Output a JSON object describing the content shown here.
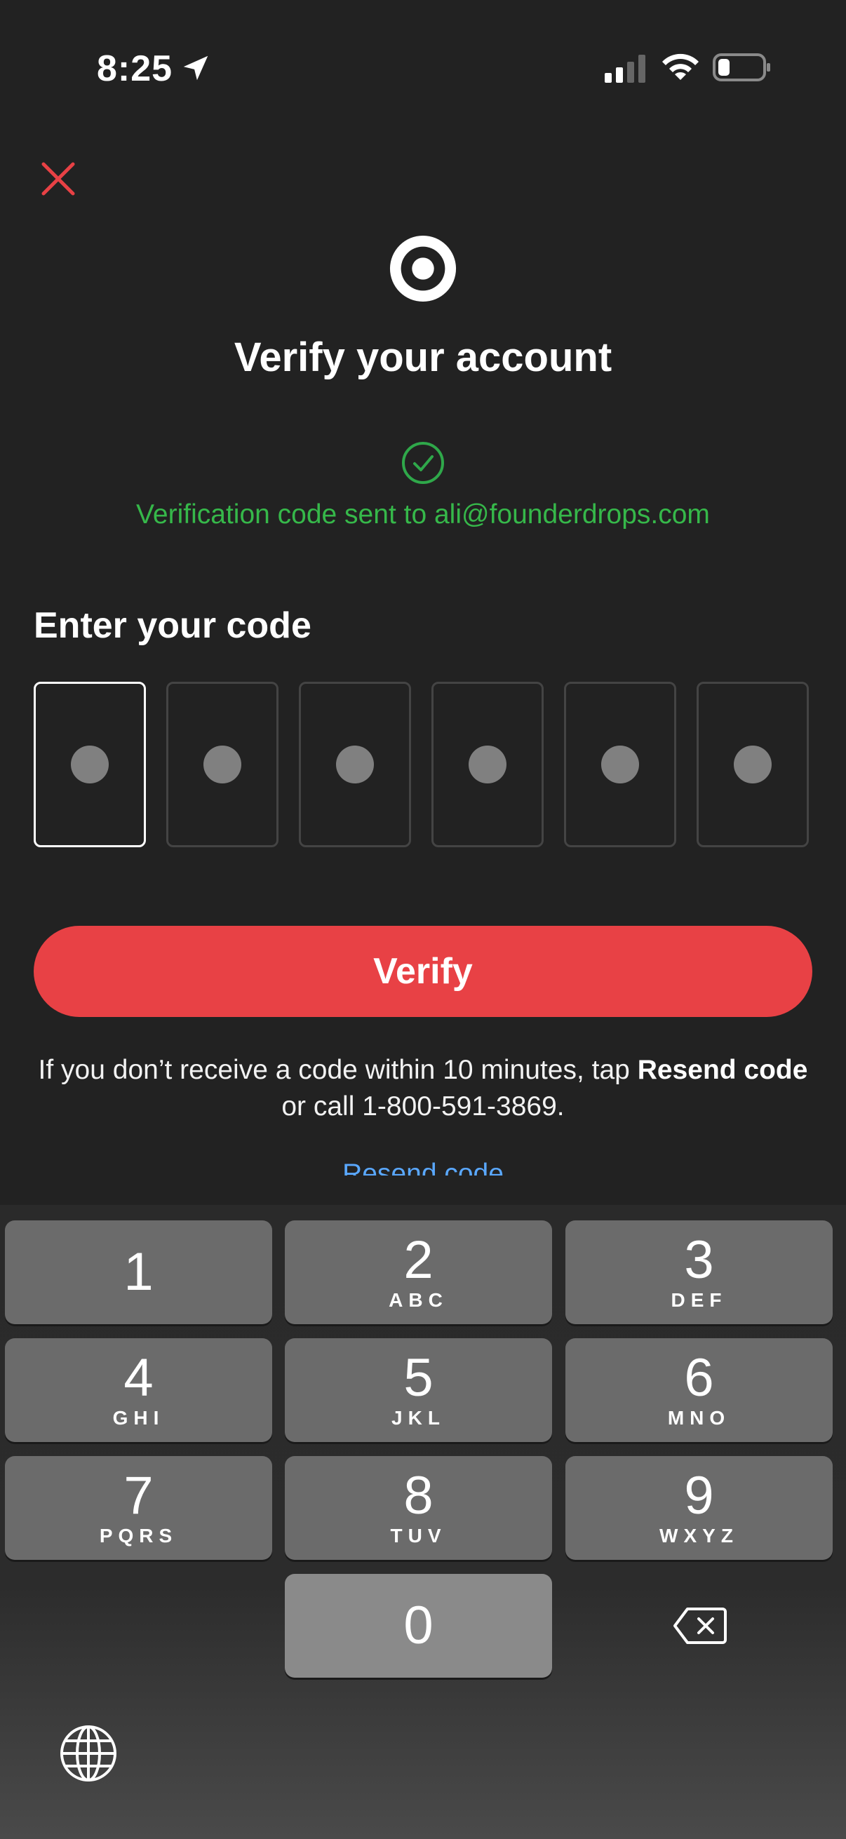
{
  "status_bar": {
    "time": "8:25"
  },
  "header": {
    "title": "Verify your account"
  },
  "notice": {
    "message": "Verification code sent to ali@founderdrops.com",
    "color": "#36b84a"
  },
  "code": {
    "label": "Enter your code",
    "digits": 6
  },
  "verify_button": {
    "label": "Verify",
    "color": "#e84145"
  },
  "help": {
    "prefix": "If you don’t receive a code within 10 minutes, tap ",
    "bold": "Resend code",
    "suffix": " or call 1-800-591-3869."
  },
  "resend_link": {
    "label": "Resend code"
  },
  "keyboard": {
    "keys": [
      {
        "num": "1",
        "letters": ""
      },
      {
        "num": "2",
        "letters": "ABC"
      },
      {
        "num": "3",
        "letters": "DEF"
      },
      {
        "num": "4",
        "letters": "GHI"
      },
      {
        "num": "5",
        "letters": "JKL"
      },
      {
        "num": "6",
        "letters": "MNO"
      },
      {
        "num": "7",
        "letters": "PQRS"
      },
      {
        "num": "8",
        "letters": "TUV"
      },
      {
        "num": "9",
        "letters": "WXYZ"
      },
      {
        "num": "0",
        "letters": ""
      }
    ]
  },
  "icons": {
    "close": "close-icon",
    "logo": "target-logo",
    "check": "check-circle-icon",
    "delete": "delete-backspace-icon",
    "globe": "globe-icon"
  }
}
